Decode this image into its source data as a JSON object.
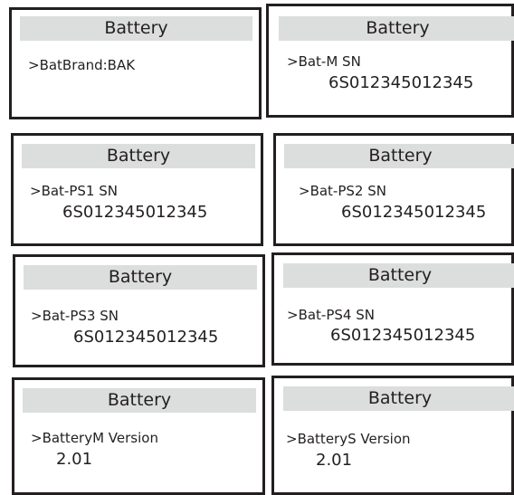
{
  "colors": {
    "border": "#231f20",
    "title_bar": "#dcdddd",
    "text": "#231f20",
    "background": "#ffffff"
  },
  "panels": [
    {
      "title": "Battery",
      "label": ">BatBrand:BAK",
      "value": ""
    },
    {
      "title": "Battery",
      "label": ">Bat-M SN",
      "value": "6S012345012345"
    },
    {
      "title": "Battery",
      "label": ">Bat-PS1 SN",
      "value": "6S012345012345"
    },
    {
      "title": "Battery",
      "label": ">Bat-PS2 SN",
      "value": "6S012345012345"
    },
    {
      "title": "Battery",
      "label": ">Bat-PS3 SN",
      "value": "6S012345012345"
    },
    {
      "title": "Battery",
      "label": ">Bat-PS4 SN",
      "value": "6S012345012345"
    },
    {
      "title": "Battery",
      "label": ">BatteryM Version",
      "value": "2.01"
    },
    {
      "title": "Battery",
      "label": ">BatteryS Version",
      "value": "2.01"
    }
  ]
}
